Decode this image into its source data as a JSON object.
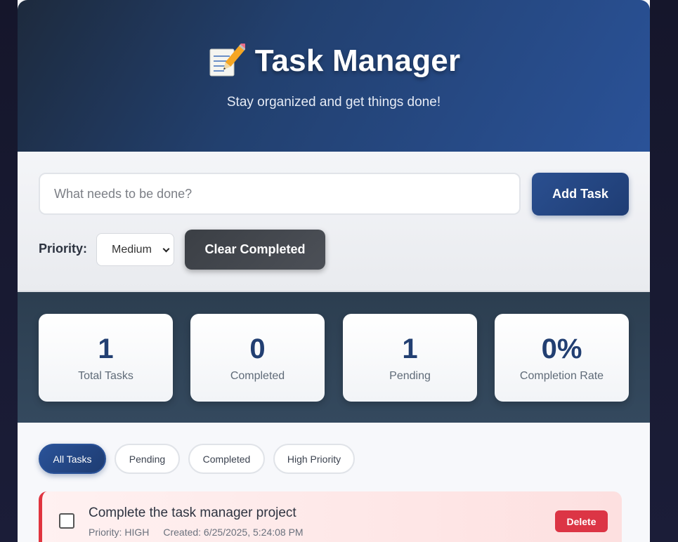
{
  "header": {
    "title_icon": "memo-pencil-icon",
    "title": "Task Manager",
    "subtitle": "Stay organized and get things done!"
  },
  "input": {
    "placeholder": "What needs to be done?",
    "value": "",
    "add_label": "Add Task",
    "priority_label": "Priority:",
    "priority_selected": "Medium",
    "clear_label": "Clear Completed"
  },
  "stats": [
    {
      "value": "1",
      "label": "Total Tasks"
    },
    {
      "value": "0",
      "label": "Completed"
    },
    {
      "value": "1",
      "label": "Pending"
    },
    {
      "value": "0%",
      "label": "Completion Rate"
    }
  ],
  "filters": [
    {
      "label": "All Tasks",
      "active": true
    },
    {
      "label": "Pending",
      "active": false
    },
    {
      "label": "Completed",
      "active": false
    },
    {
      "label": "High Priority",
      "active": false
    }
  ],
  "tasks": [
    {
      "title": "Complete the task manager project",
      "priority": "Priority: HIGH",
      "created": "Created: 6/25/2025, 5:24:08 PM",
      "completed": false,
      "delete_label": "Delete"
    }
  ],
  "colors": {
    "accent": "#2a5298",
    "danger": "#dc3545",
    "stats_bg": "#2c3e50"
  }
}
